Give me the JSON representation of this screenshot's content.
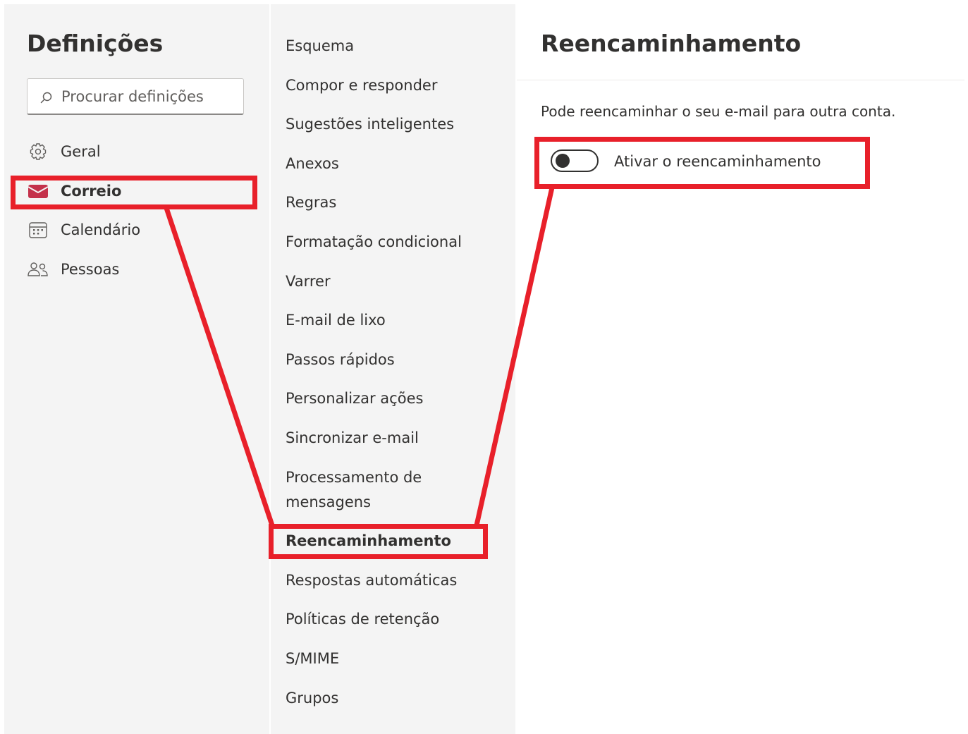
{
  "settings": {
    "title": "Definições",
    "search_placeholder": "Procurar definições"
  },
  "nav": {
    "items": [
      {
        "label": "Geral",
        "icon": "gear-icon"
      },
      {
        "label": "Correio",
        "icon": "mail-icon",
        "active": true
      },
      {
        "label": "Calendário",
        "icon": "calendar-icon"
      },
      {
        "label": "Pessoas",
        "icon": "people-icon"
      }
    ]
  },
  "mail_sections": {
    "items": [
      "Esquema",
      "Compor e responder",
      "Sugestões inteligentes",
      "Anexos",
      "Regras",
      "Formatação condicional",
      "Varrer",
      "E-mail de lixo",
      "Passos rápidos",
      "Personalizar ações",
      "Sincronizar e-mail",
      "Processamento de",
      "mensagens",
      "Reencaminhamento",
      "Respostas automáticas",
      "Políticas de retenção",
      "S/MIME",
      "Grupos"
    ],
    "active": "Reencaminhamento"
  },
  "pane": {
    "title": "Reencaminhamento",
    "description": "Pode reencaminhar o seu e-mail para outra conta.",
    "toggle_label": "Ativar o reencaminhamento",
    "toggle_on": false
  },
  "colors": {
    "highlight": "#e8202a",
    "accent": "#c4314b",
    "panel_bg": "#f4f4f4"
  }
}
